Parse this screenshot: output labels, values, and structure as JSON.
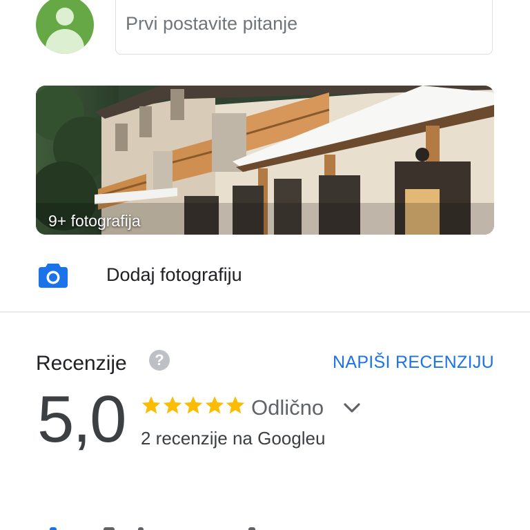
{
  "question": {
    "placeholder": "Prvi postavite pitanje"
  },
  "photo": {
    "caption": "9+ fotografija"
  },
  "add_photo": {
    "label": "Dodaj fotografiju",
    "icon": "camera-icon"
  },
  "reviews": {
    "title": "Recenzije",
    "help_icon": "help-icon",
    "help_glyph": "?",
    "write_review_label": "NAPIŠI RECENZIJU",
    "score": "5,0",
    "star_count": 5,
    "rating_label": "Odlično",
    "review_count_text": "2 recenzije na Googleu"
  },
  "colors": {
    "accent": "#1a73e8",
    "star": "#fbbc04",
    "avatar": "#65a845",
    "camera": "#1a73e8"
  }
}
